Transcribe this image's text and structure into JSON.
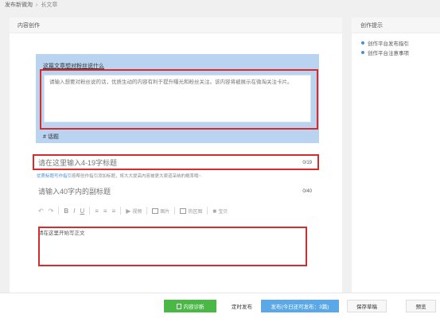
{
  "breadcrumb": {
    "root": "发布新微淘",
    "separator": "›",
    "current": "长文章"
  },
  "main": {
    "header": "内容创作"
  },
  "card": {
    "prompt": "这篇文章想对粉丝说什么",
    "placeholder": "请输入想要对粉丝说的话，优质生动的内容有利于提升曝光和粉丝关注。该内容将被展示在微淘关注卡片。",
    "topic": "# 话题"
  },
  "title_field": {
    "placeholder": "请在这里输入4-19字标题",
    "counter": "0/19"
  },
  "hint": {
    "link": "优质标题写作指引",
    "text": "按帮创作指引添加标题，将大大提高内容被更大渠道采纳的概率哦~"
  },
  "subtitle_field": {
    "placeholder": "请输入40字内的副标题",
    "counter": "0/40"
  },
  "toolbar": {
    "undo": "↶",
    "redo": "↷",
    "bold": "B",
    "italic": "I",
    "underline": "U",
    "align_left": "≡",
    "align_center": "≡",
    "align_right": "≡",
    "video_label": "视频",
    "image_label": "图片",
    "hotspot_label": "热区图",
    "product_label": "宝贝"
  },
  "body_field": {
    "placeholder": "请在这里开始写正文"
  },
  "side": {
    "header": "创作提示",
    "items": [
      "创作平台发布指引",
      "创作平台注意事项"
    ]
  },
  "bottom": {
    "diagnose": "内容诊断",
    "timer": "定时发布",
    "publish": "发布(今日还可发布：3篇)",
    "draft": "保存草稿",
    "preview": "预览"
  },
  "colors": {
    "card": "#b9d3f0",
    "highlight": "#d82b2b",
    "diagnose": "#4ab845",
    "publish": "#5ba8e8",
    "link": "#4a90d9"
  }
}
